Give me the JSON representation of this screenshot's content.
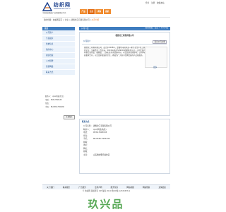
{
  "header": {
    "logo_title": "纺织网",
    "logo_url": "www.fzwnet.com.cn",
    "slogan": "中国纺织服装行业网络贸易平台",
    "top_links": [
      "登录",
      "注册",
      "收藏本站"
    ],
    "nav_tabs": [
      "产品",
      "企业",
      "求购",
      "商机"
    ],
    "active_tab": 1
  },
  "breadcrumb": {
    "prefix": "您的位置：纺织网首页 > 企业 > 德胜化工有限有限公司 >",
    "current": "公司介绍"
  },
  "sidebar": {
    "title": "首页",
    "items": [
      "公司简介",
      "产品展示",
      "供求信息",
      "新闻中心",
      "诚信档案",
      "人才招聘",
      "营销网络",
      "联系方式"
    ]
  },
  "sidebar_contact": {
    "rows": [
      "联系人：  cpxx列表(先生)",
      "电话：  0536-7993138",
      "传真：",
      "手机：  86-0536-7993138"
    ],
    "button_label": "在线留言"
  },
  "main": {
    "header_left": "公司介绍",
    "header_right": "您的位置：首页 > 公司介绍",
    "company_name": "德胜化工有限有限公司",
    "tab_label": "公司简介",
    "tab_button": "显示公司全称",
    "intro_text": "德胜化工有限有限公司，成立于2008年，是潍坊市昌乐县一家专业生产化工原料的企业，注册资金三百万元，2014年通过ISO9001质量体系认证。公司主要产品有聚合氯化铝、硫酸铝、三氯化铁等水处理药剂，产品远销全国各地，公司本着以质量求生存，以信誉求发展的宗旨，竭诚为广大客户提供优质的产品和服务。",
    "more_label": "更多",
    "detail_title": "联系方式",
    "detail_rows": [
      {
        "k": "公司名称：",
        "v": "德胜化工有限有限公司"
      },
      {
        "k": "联系人：",
        "v": "cpxx列表(先生)"
      },
      {
        "k": "电话：",
        "v": "0536-7993138"
      },
      {
        "k": "传真：",
        "v": ""
      },
      {
        "k": "手机：",
        "v": "86-0536-7993138"
      },
      {
        "k": "邮编：",
        "v": ""
      },
      {
        "k": "地址：",
        "v": ""
      },
      {
        "k": "网址：",
        "v": ""
      },
      {
        "k": "邮箱：",
        "v": ""
      },
      {
        "k": "主营：",
        "v": "山东潍坊聚合氯化铝"
      }
    ]
  },
  "footer": {
    "links": [
      "关于我们",
      "联系我们",
      "广告服务",
      "法律声明",
      "服务条款",
      "网站地图",
      "网站帮助",
      "友情链接"
    ],
    "copyright": "© 纺织网 版权所有 ICP 备案 2010 鲁ICP备 12345678-1"
  },
  "watermark": "玖兴品"
}
